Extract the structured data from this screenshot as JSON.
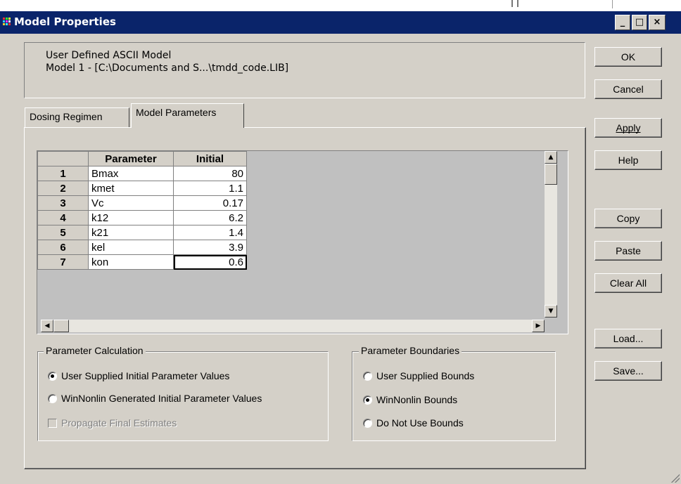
{
  "window": {
    "title": "Model Properties",
    "controls": {
      "minimize": "_",
      "maximize": "□",
      "close": "×"
    }
  },
  "info": {
    "line1": "User Defined ASCII Model",
    "line2": "Model 1  - [C:\\Documents and S...\\tmdd_code.LIB]"
  },
  "buttons": {
    "ok": "OK",
    "cancel": "Cancel",
    "apply": "Apply",
    "help": "Help",
    "copy": "Copy",
    "paste": "Paste",
    "clear_all": "Clear All",
    "load": "Load...",
    "save": "Save..."
  },
  "tabs": [
    {
      "label": "Dosing Regimen",
      "active": false
    },
    {
      "label": "Model Parameters",
      "active": true
    }
  ],
  "grid": {
    "columns": [
      "Parameter",
      "Initial"
    ],
    "rows": [
      {
        "n": "1",
        "param": "Bmax",
        "initial": "80"
      },
      {
        "n": "2",
        "param": "kmet",
        "initial": "1.1"
      },
      {
        "n": "3",
        "param": "Vc",
        "initial": "0.17"
      },
      {
        "n": "4",
        "param": "k12",
        "initial": "6.2"
      },
      {
        "n": "5",
        "param": "k21",
        "initial": "1.4"
      },
      {
        "n": "6",
        "param": "kel",
        "initial": "3.9"
      },
      {
        "n": "7",
        "param": "kon",
        "initial": "0.6"
      }
    ],
    "selected_row": "7"
  },
  "calculation": {
    "legend": "Parameter Calculation",
    "options": [
      {
        "label": "User Supplied Initial Parameter Values",
        "checked": true
      },
      {
        "label": "WinNonlin Generated Initial Parameter Values",
        "checked": false
      }
    ],
    "propagate": {
      "label": "Propagate Final Estimates",
      "checked": false,
      "disabled": true
    }
  },
  "boundaries": {
    "legend": "Parameter Boundaries",
    "options": [
      {
        "label": "User Supplied Bounds",
        "checked": false
      },
      {
        "label": "WinNonlin Bounds",
        "checked": true
      },
      {
        "label": "Do Not Use Bounds",
        "checked": false
      }
    ]
  }
}
